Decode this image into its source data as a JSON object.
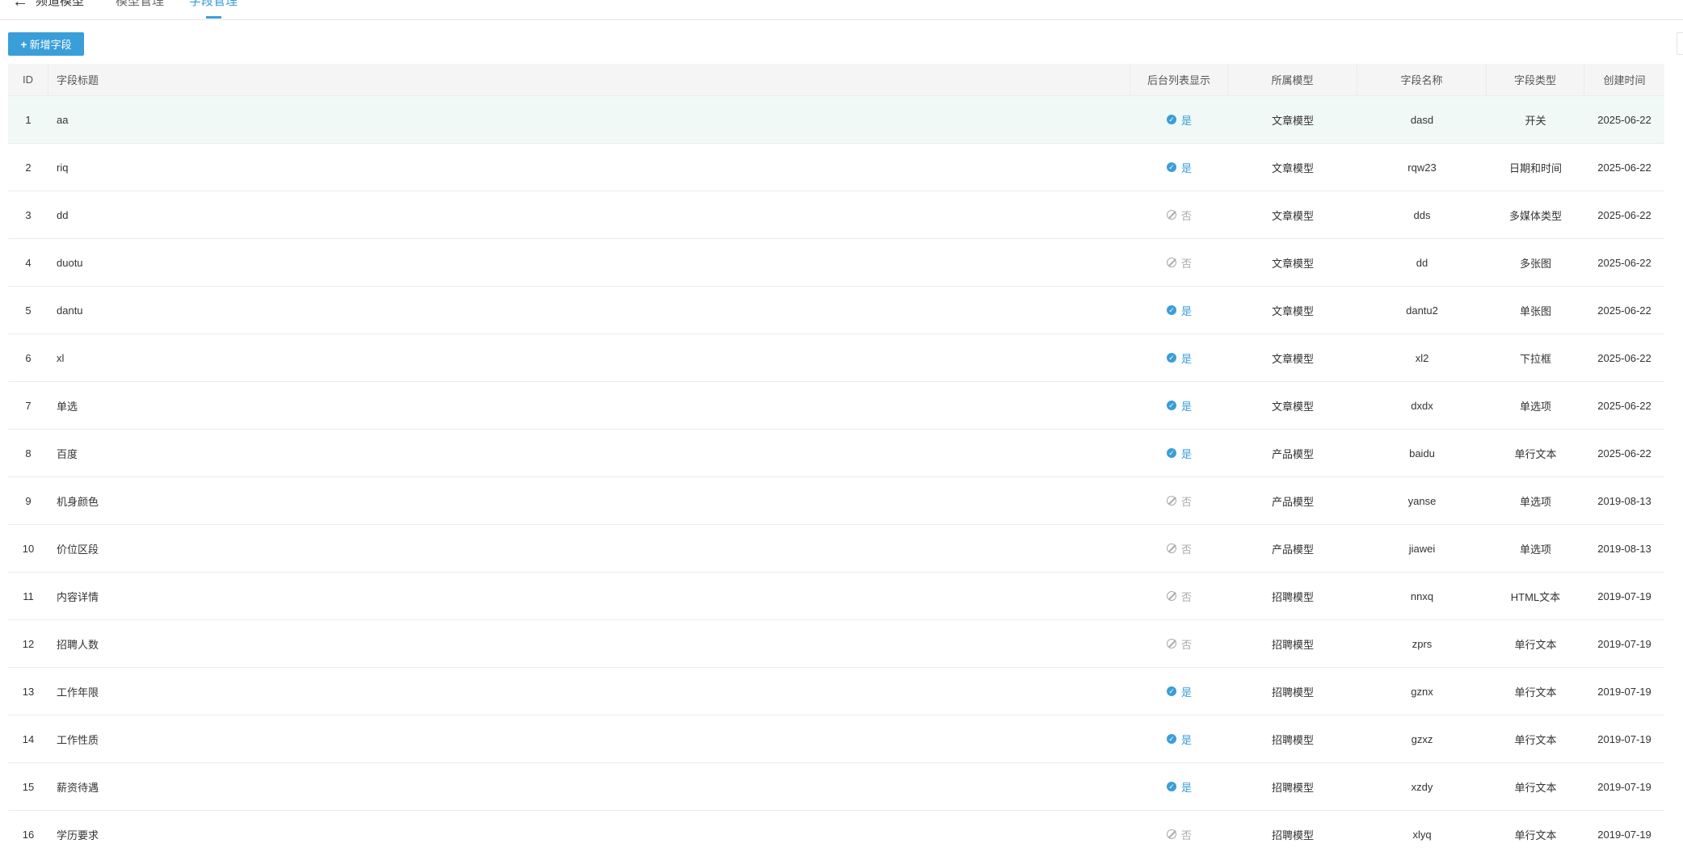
{
  "nav": {
    "back_icon": "arrow-left-icon",
    "title": "频道模型",
    "tabs": [
      {
        "label": "模型管理",
        "active": false
      },
      {
        "label": "字段管理",
        "active": true
      }
    ]
  },
  "toolbar": {
    "add_label": "新增字段",
    "add_icon": "plus-icon"
  },
  "colors": {
    "accent": "#3a9ed8",
    "highlight_row": "#f0f9f6",
    "header_bg": "#f5f5f5",
    "muted": "#aaaaaa"
  },
  "table": {
    "headers": {
      "id": "ID",
      "title": "字段标题",
      "show": "后台列表显示",
      "model": "所属模型",
      "name": "字段名称",
      "type": "字段类型",
      "time": "创建时间"
    },
    "rows": [
      {
        "id": "1",
        "title": "aa",
        "show": "是",
        "show_flag": true,
        "model": "文章模型",
        "name": "dasd",
        "type": "开关",
        "time": "2025-06-22"
      },
      {
        "id": "2",
        "title": "riq",
        "show": "是",
        "show_flag": true,
        "model": "文章模型",
        "name": "rqw23",
        "type": "日期和时间",
        "time": "2025-06-22"
      },
      {
        "id": "3",
        "title": "dd",
        "show": "否",
        "show_flag": false,
        "model": "文章模型",
        "name": "dds",
        "type": "多媒体类型",
        "time": "2025-06-22"
      },
      {
        "id": "4",
        "title": "duotu",
        "show": "否",
        "show_flag": false,
        "model": "文章模型",
        "name": "dd",
        "type": "多张图",
        "time": "2025-06-22"
      },
      {
        "id": "5",
        "title": "dantu",
        "show": "是",
        "show_flag": true,
        "model": "文章模型",
        "name": "dantu2",
        "type": "单张图",
        "time": "2025-06-22"
      },
      {
        "id": "6",
        "title": "xl",
        "show": "是",
        "show_flag": true,
        "model": "文章模型",
        "name": "xl2",
        "type": "下拉框",
        "time": "2025-06-22"
      },
      {
        "id": "7",
        "title": "单选",
        "show": "是",
        "show_flag": true,
        "model": "文章模型",
        "name": "dxdx",
        "type": "单选项",
        "time": "2025-06-22"
      },
      {
        "id": "8",
        "title": "百度",
        "show": "是",
        "show_flag": true,
        "model": "产品模型",
        "name": "baidu",
        "type": "单行文本",
        "time": "2025-06-22"
      },
      {
        "id": "9",
        "title": "机身颜色",
        "show": "否",
        "show_flag": false,
        "model": "产品模型",
        "name": "yanse",
        "type": "单选项",
        "time": "2019-08-13"
      },
      {
        "id": "10",
        "title": "价位区段",
        "show": "否",
        "show_flag": false,
        "model": "产品模型",
        "name": "jiawei",
        "type": "单选项",
        "time": "2019-08-13"
      },
      {
        "id": "11",
        "title": "内容详情",
        "show": "否",
        "show_flag": false,
        "model": "招聘模型",
        "name": "nnxq",
        "type": "HTML文本",
        "time": "2019-07-19"
      },
      {
        "id": "12",
        "title": "招聘人数",
        "show": "否",
        "show_flag": false,
        "model": "招聘模型",
        "name": "zprs",
        "type": "单行文本",
        "time": "2019-07-19"
      },
      {
        "id": "13",
        "title": "工作年限",
        "show": "是",
        "show_flag": true,
        "model": "招聘模型",
        "name": "gznx",
        "type": "单行文本",
        "time": "2019-07-19"
      },
      {
        "id": "14",
        "title": "工作性质",
        "show": "是",
        "show_flag": true,
        "model": "招聘模型",
        "name": "gzxz",
        "type": "单行文本",
        "time": "2019-07-19"
      },
      {
        "id": "15",
        "title": "薪资待遇",
        "show": "是",
        "show_flag": true,
        "model": "招聘模型",
        "name": "xzdy",
        "type": "单行文本",
        "time": "2019-07-19"
      },
      {
        "id": "16",
        "title": "学历要求",
        "show": "否",
        "show_flag": false,
        "model": "招聘模型",
        "name": "xlyq",
        "type": "单行文本",
        "time": "2019-07-19"
      }
    ]
  }
}
